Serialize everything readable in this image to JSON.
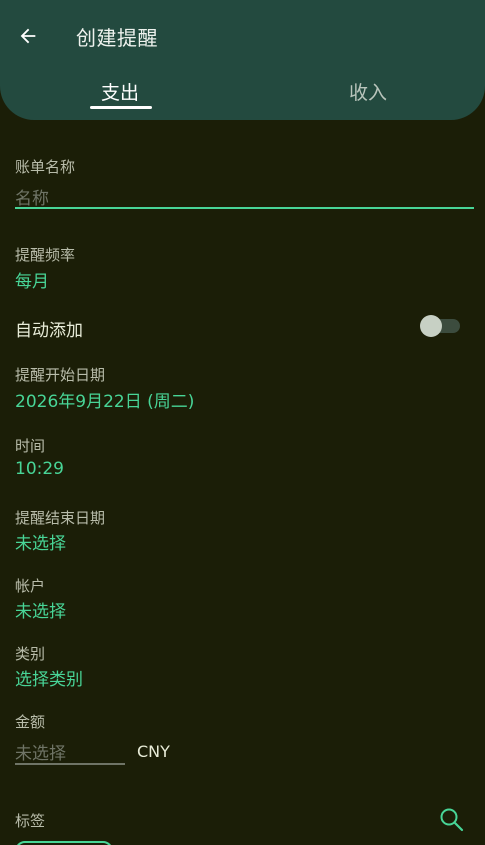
{
  "header": {
    "title": "创建提醒",
    "tabs": [
      {
        "label": "支出",
        "active": true
      },
      {
        "label": "收入",
        "active": false
      }
    ]
  },
  "form": {
    "bill_name": {
      "label": "账单名称",
      "placeholder": "名称"
    },
    "frequency": {
      "label": "提醒频率",
      "value": "每月"
    },
    "auto_add": {
      "label": "自动添加",
      "enabled": false
    },
    "start_date": {
      "label": "提醒开始日期",
      "value": "2026年9月22日 (周二)"
    },
    "time": {
      "label": "时间",
      "value": "10:29"
    },
    "end_date": {
      "label": "提醒结束日期",
      "value": "未选择"
    },
    "account": {
      "label": "帐户",
      "value": "未选择"
    },
    "category": {
      "label": "类别",
      "value": "选择类别"
    },
    "amount": {
      "label": "金额",
      "placeholder": "未选择",
      "currency": "CNY"
    },
    "tags": {
      "label": "标签"
    }
  },
  "icons": {
    "back": "arrow-left-icon",
    "search": "search-icon",
    "toggle": "toggle-switch"
  },
  "colors": {
    "accent": "#48d597",
    "background": "#1b1e07",
    "header": "#234a3f"
  }
}
